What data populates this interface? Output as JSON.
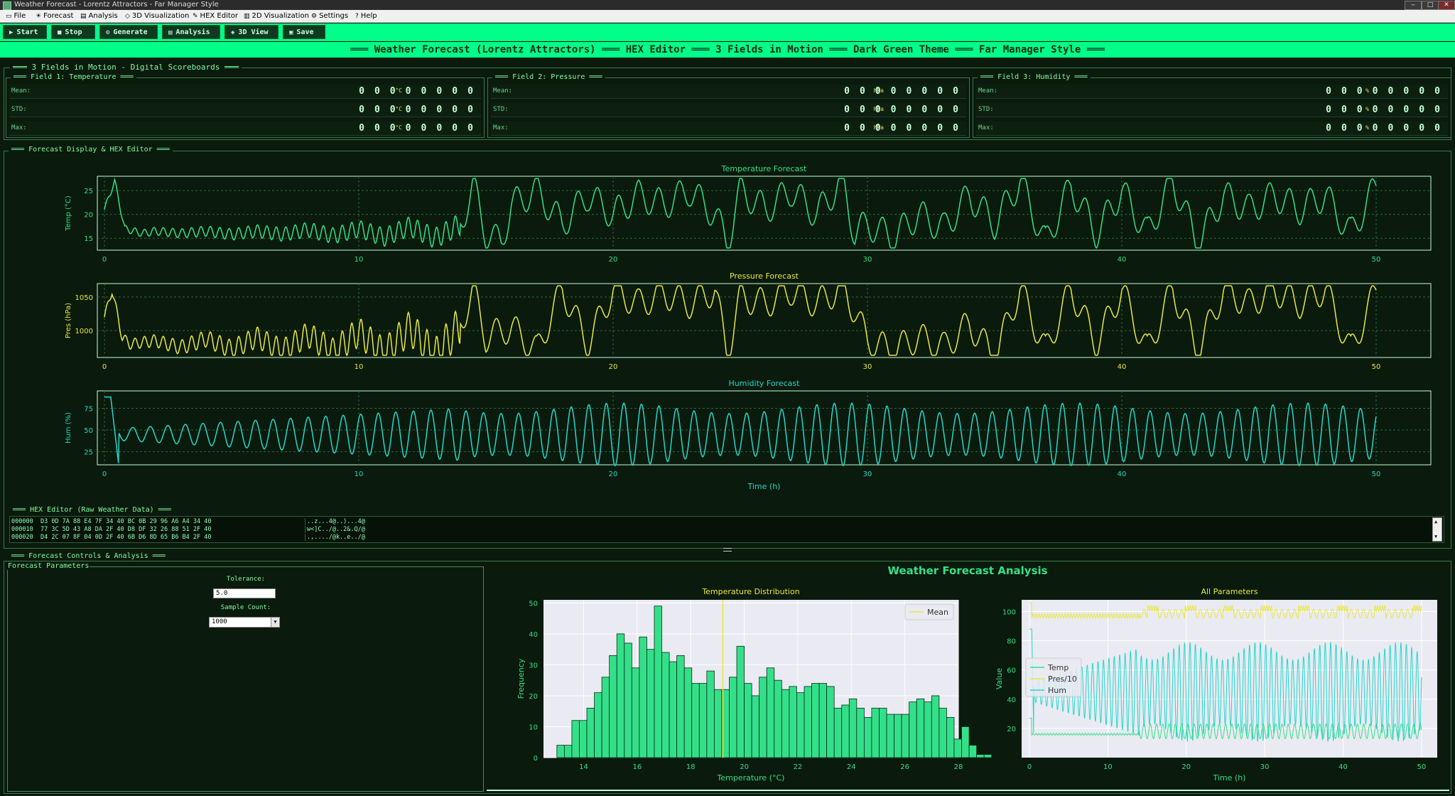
{
  "window": {
    "title": "Weather Forecast - Lorentz Attractors - Far Manager Style",
    "controls": [
      "‒",
      "□",
      "✕"
    ]
  },
  "menu": [
    {
      "label": "File",
      "icon": "file-icon"
    },
    {
      "label": "Forecast",
      "icon": "forecast-icon"
    },
    {
      "label": "Analysis",
      "icon": "analysis-icon"
    },
    {
      "label": "3D Visualization",
      "icon": "cube-icon"
    },
    {
      "label": "HEX Editor",
      "icon": "hex-icon"
    },
    {
      "label": "2D Visualization",
      "icon": "chart-icon"
    },
    {
      "label": "Settings",
      "icon": "gear-icon"
    },
    {
      "label": "Help",
      "icon": "help-icon"
    }
  ],
  "toolbar": [
    {
      "label": "Start",
      "icon": "play-icon"
    },
    {
      "label": "Stop",
      "icon": "stop-icon"
    },
    {
      "label": "Generate",
      "icon": "generate-icon"
    },
    {
      "label": "Analysis",
      "icon": "analysis-icon"
    },
    {
      "label": "3D View",
      "icon": "cube-icon"
    },
    {
      "label": "Save",
      "icon": "save-icon"
    }
  ],
  "banner": "═══ Weather Forecast (Lorentz Attractors) ═══ HEX Editor ═══ 3 Fields in Motion ═══ Dark Green Theme ═══ Far Manager Style ═══",
  "scoreboards": {
    "title": "3 Fields in Motion - Digital Scoreboards",
    "fields": [
      {
        "title": "Field 1: Temperature",
        "unit": "°C",
        "rows": [
          {
            "label": "Mean:",
            "value": "00000000"
          },
          {
            "label": "STD:",
            "value": "00000000"
          },
          {
            "label": "Max:",
            "value": "00000000"
          }
        ]
      },
      {
        "title": "Field 2: Pressure",
        "unit": "hPa",
        "rows": [
          {
            "label": "Mean:",
            "value": "00000000"
          },
          {
            "label": "STD:",
            "value": "00000000"
          },
          {
            "label": "Max:",
            "value": "00000000"
          }
        ]
      },
      {
        "title": "Field 3: Humidity",
        "unit": "%",
        "rows": [
          {
            "label": "Mean:",
            "value": "00000000"
          },
          {
            "label": "STD:",
            "value": "00000000"
          },
          {
            "label": "Max:",
            "value": "00000000"
          }
        ]
      }
    ]
  },
  "forecast_display": {
    "title": "Forecast Display & HEX Editor"
  },
  "hex_editor": {
    "title": "HEX Editor (Raw Weather Data)",
    "lines": [
      {
        "offset": "000000",
        "hex": "D3 0D 7A 88 E4 7F 34 40 BC 0B 29 96 A6 A4 34 40",
        "ascii": "..z...4@..)...4@"
      },
      {
        "offset": "000010",
        "hex": "77 3C 5D 43 A8 DA 2F 40 D8 DF 32 26 88 51 2F 40",
        "ascii": "w<]C../@..2&.Q/@"
      },
      {
        "offset": "000020",
        "hex": "D4 2C 07 8F 04 0D 2F 40 6B D6 8D 65 B6 B4 2F 40",
        "ascii": ".,..../@k..e../@"
      }
    ]
  },
  "controls": {
    "title": "Forecast Controls & Analysis",
    "params_title": "Forecast Parameters",
    "tolerance_label": "Tolerance:",
    "tolerance_value": "5.0",
    "sample_label": "Sample Count:",
    "sample_value": "1000"
  },
  "analysis_title": "Weather Forecast Analysis",
  "colors": {
    "temp": "#33e089",
    "pres": "#e8e840",
    "hum": "#22d8cc",
    "accent": "#00ff88"
  },
  "chart_data": [
    {
      "type": "line",
      "title": "Temperature Forecast",
      "xlabel": "",
      "ylabel": "Temp (°C)",
      "xlim": [
        0,
        50
      ],
      "ylim": [
        12.5,
        28
      ],
      "xticks": [
        0,
        10,
        20,
        30,
        40,
        50
      ],
      "yticks": [
        15,
        20,
        25
      ],
      "grid": true,
      "series": [
        {
          "values_x": [
            0,
            0.4,
            0.8,
            1.5,
            2,
            3,
            4,
            5,
            6,
            7,
            8,
            9,
            10,
            11,
            12,
            13,
            14,
            14.5,
            15,
            15.6,
            16,
            17,
            18,
            19,
            19.5,
            20,
            21,
            22,
            23,
            24,
            24.5,
            25,
            26,
            27,
            28,
            29,
            29.5,
            30,
            31,
            32,
            33,
            34,
            35,
            36,
            37,
            38,
            39,
            40,
            41,
            42,
            43,
            44,
            45,
            46,
            47,
            48,
            49,
            50
          ],
          "values": [
            21,
            27,
            17,
            16,
            16.5,
            16,
            16.5,
            15.8,
            16.5,
            15.8,
            16.8,
            15.5,
            17,
            15.2,
            17.5,
            15,
            18,
            26,
            16,
            14,
            22,
            25,
            18,
            24,
            22,
            20,
            24,
            22,
            25,
            20,
            14,
            25,
            21,
            25,
            20,
            27,
            16,
            18,
            15,
            20,
            17,
            24,
            18,
            27,
            14,
            26,
            16,
            25,
            16,
            27,
            14,
            24,
            21,
            24,
            21,
            24,
            16,
            26
          ]
        }
      ]
    },
    {
      "type": "line",
      "title": "Pressure Forecast",
      "xlabel": "",
      "ylabel": "Pres (hPa)",
      "xlim": [
        0,
        50
      ],
      "ylim": [
        960,
        1070
      ],
      "xticks": [
        0,
        10,
        20,
        30,
        40,
        50
      ],
      "yticks": [
        1000,
        1050
      ],
      "grid": true,
      "series": [
        {
          "values_x": [
            0,
            0.3,
            0.7,
            1,
            2,
            3,
            4,
            5,
            6,
            7,
            8,
            9,
            10,
            11,
            12,
            13,
            14,
            14.5,
            15,
            16,
            17,
            18,
            19,
            20,
            21,
            22,
            23,
            24,
            24.5,
            25,
            26,
            27,
            28,
            29,
            29.5,
            30,
            31,
            32,
            33,
            34,
            35,
            36,
            37,
            38,
            39,
            40,
            41,
            42,
            43,
            44,
            45,
            46,
            47,
            48,
            49,
            50
          ],
          "values": [
            1020,
            1060,
            990,
            980,
            985,
            975,
            988,
            972,
            990,
            970,
            994,
            968,
            998,
            965,
            1004,
            962,
            1010,
            1060,
            990,
            1005,
            970,
            1062,
            980,
            1060,
            1040,
            1055,
            1040,
            1060,
            965,
            1050,
            1040,
            1060,
            1040,
            1064,
            1030,
            985,
            970,
            990,
            975,
            1010,
            960,
            1062,
            970,
            1062,
            980,
            1060,
            970,
            1062,
            970,
            1060,
            1040,
            1060,
            1040,
            1062,
            970,
            1060
          ]
        }
      ]
    },
    {
      "type": "line",
      "title": "Humidity Forecast",
      "xlabel": "Time (h)",
      "ylabel": "Hum (%)",
      "xlim": [
        0,
        50
      ],
      "ylim": [
        10,
        95
      ],
      "xticks": [
        0,
        10,
        20,
        30,
        40,
        50
      ],
      "yticks": [
        25,
        50,
        75
      ],
      "grid": true,
      "series": [
        {
          "oscillating": true,
          "start": 88,
          "amplitude_start": 6,
          "amplitude_end": 30,
          "mean": 45
        }
      ]
    },
    {
      "type": "bar",
      "title": "Temperature Distribution",
      "xlabel": "Temperature (°C)",
      "ylabel": "Frequency",
      "xlim": [
        12.5,
        28
      ],
      "ylim": [
        0,
        51
      ],
      "xticks": [
        14,
        16,
        18,
        20,
        22,
        24,
        26,
        28
      ],
      "yticks": [
        0,
        10,
        20,
        30,
        40,
        50
      ],
      "legend": [
        "Mean"
      ],
      "legend_position": "top-right",
      "mean": 19.2,
      "bin_start": 13.0,
      "bin_width": 0.28,
      "values": [
        4,
        4,
        12,
        12,
        16,
        21,
        26,
        33,
        40,
        37,
        29,
        39,
        35,
        49,
        34,
        31,
        33,
        29,
        24,
        24,
        28,
        22,
        22,
        26,
        36,
        24,
        20,
        26,
        29,
        25,
        22,
        23,
        21,
        23,
        24,
        24,
        23,
        16,
        17,
        19,
        16,
        13,
        16,
        16,
        14,
        14,
        14,
        18,
        19,
        18,
        20,
        16,
        13,
        6,
        10,
        4,
        1,
        1
      ],
      "colors": {
        "bar": "#33e089",
        "mean": "#e8e840"
      }
    },
    {
      "type": "line",
      "title": "All Parameters",
      "xlabel": "Time (h)",
      "ylabel": "Value",
      "xlim": [
        -1,
        52
      ],
      "ylim": [
        0,
        108
      ],
      "xticks": [
        0,
        10,
        20,
        30,
        40,
        50
      ],
      "yticks": [
        20,
        40,
        60,
        80,
        100
      ],
      "legend": [
        "Temp",
        "Pres/10",
        "Hum"
      ],
      "legend_position": "center-left",
      "series": [
        {
          "name": "Temp",
          "color": "#33e089"
        },
        {
          "name": "Pres/10",
          "color": "#e8e840"
        },
        {
          "name": "Hum",
          "color": "#22d8cc"
        }
      ]
    }
  ]
}
